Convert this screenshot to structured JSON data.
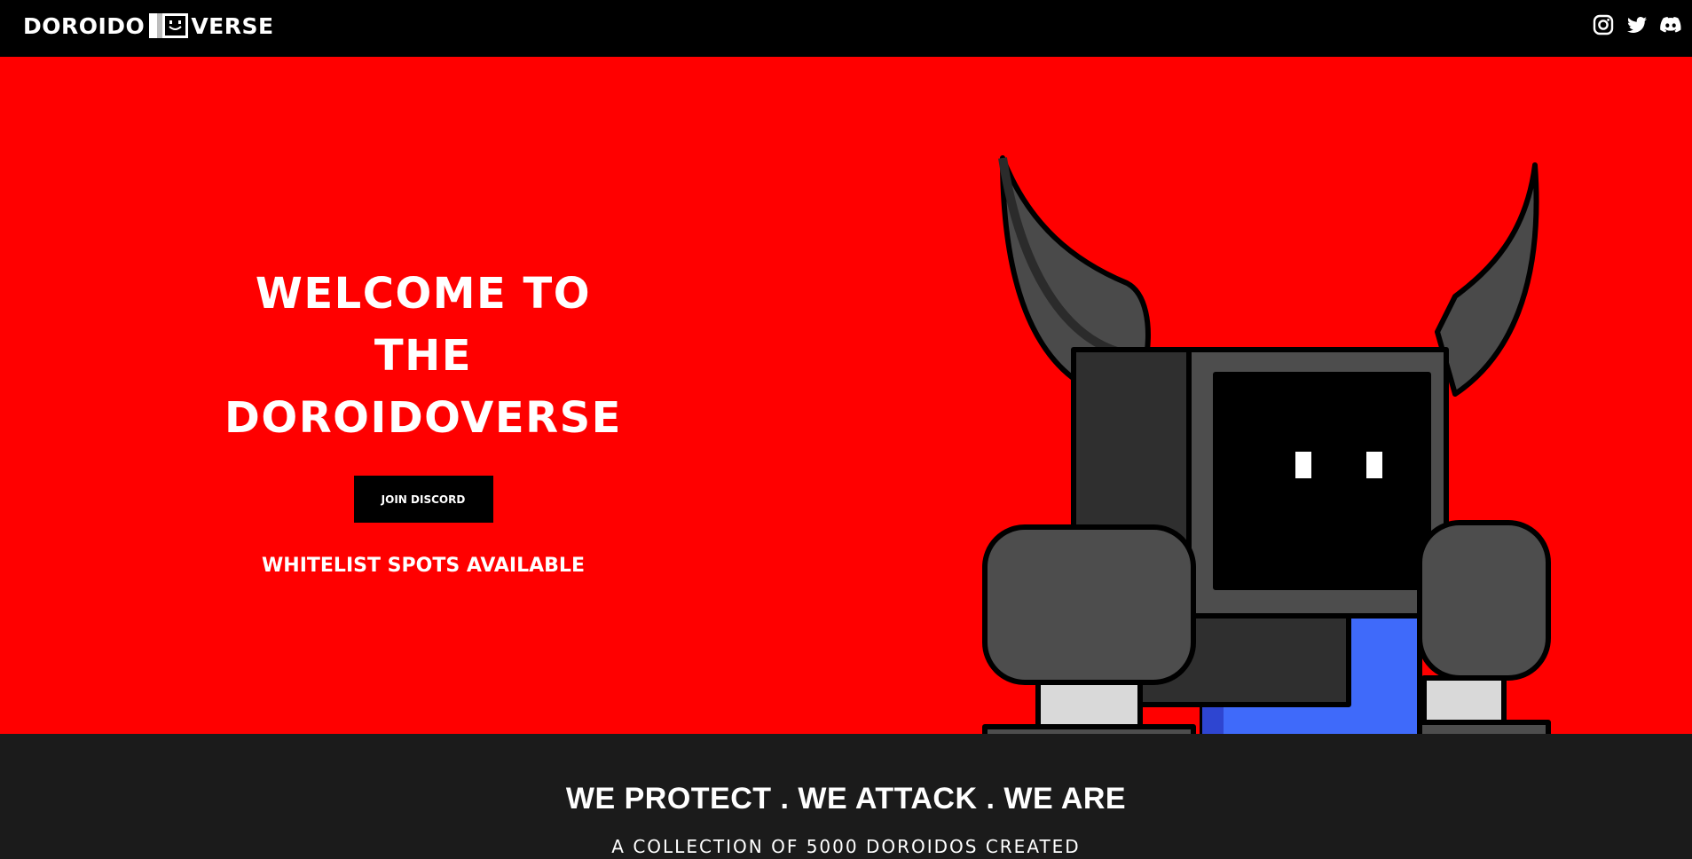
{
  "header": {
    "logo_left": "DOROIDO",
    "logo_right": "VERSE",
    "social_icons": [
      "instagram-icon",
      "twitter-icon",
      "discord-icon"
    ]
  },
  "hero": {
    "title_line1": "WELCOME TO THE",
    "title_line2": "DOROIDOVERSE",
    "button_label": "JOIN DISCORD",
    "subtitle": "WHITELIST SPOTS AVAILABLE",
    "background_color": "#ff0000"
  },
  "section": {
    "tagline": "WE PROTECT . WE ATTACK . WE ARE",
    "description": "A COLLECTION OF 5000 DOROIDOS CREATED"
  }
}
